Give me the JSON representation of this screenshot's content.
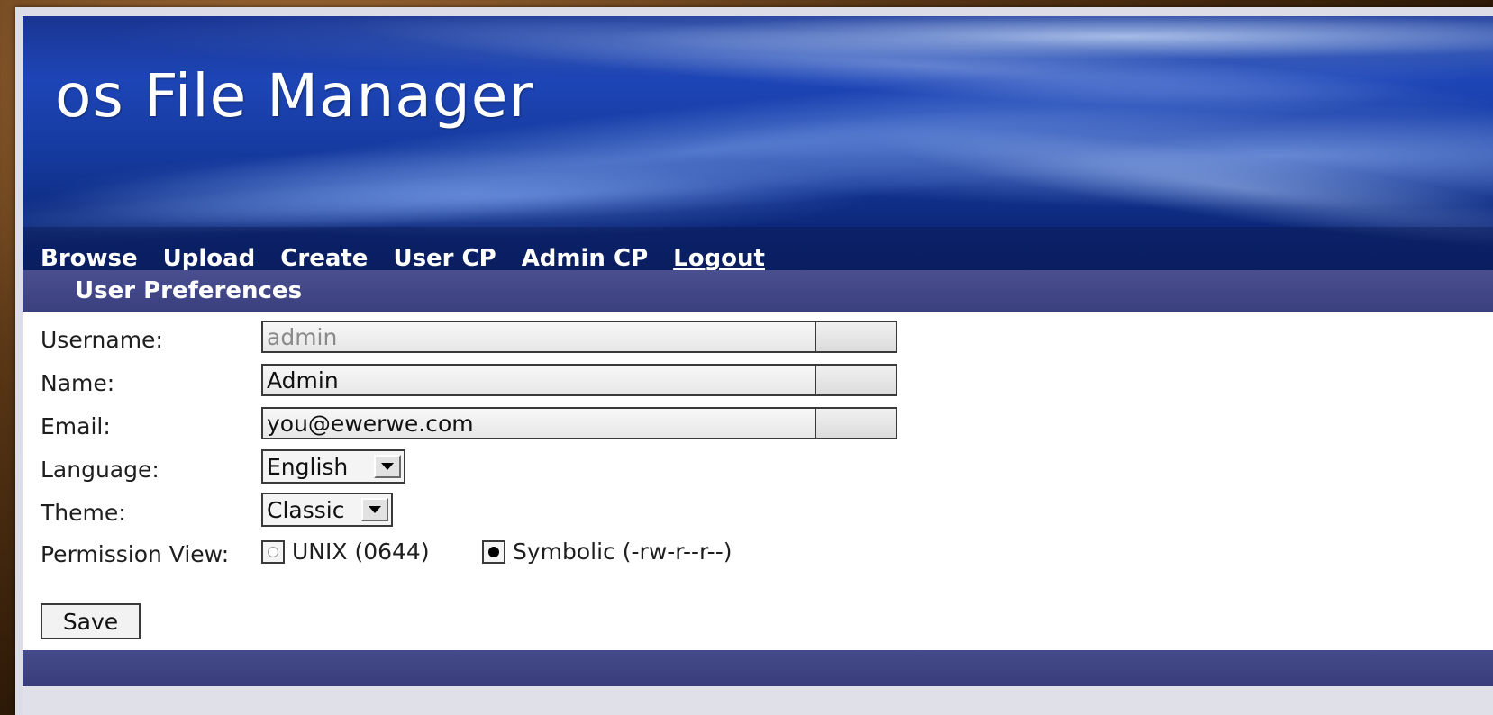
{
  "app": {
    "title": "os File Manager"
  },
  "nav": {
    "items": [
      {
        "id": "browse",
        "label": "Browse"
      },
      {
        "id": "upload",
        "label": "Upload"
      },
      {
        "id": "create",
        "label": "Create"
      },
      {
        "id": "user-cp",
        "label": "User CP"
      },
      {
        "id": "admin-cp",
        "label": "Admin CP"
      },
      {
        "id": "logout",
        "label": "Logout"
      }
    ]
  },
  "section": {
    "title": "User Preferences"
  },
  "form": {
    "username": {
      "label": "Username:",
      "value": "admin",
      "disabled": true
    },
    "name": {
      "label": "Name:",
      "value": "Admin"
    },
    "email": {
      "label": "Email:",
      "value": "you@ewerwe.com"
    },
    "language": {
      "label": "Language:",
      "selected": "English"
    },
    "theme": {
      "label": "Theme:",
      "selected": "Classic"
    },
    "permission_view": {
      "label": "Permission View:",
      "options": [
        {
          "label": "UNIX (0644)",
          "checked": false
        },
        {
          "label": "Symbolic (-rw-r--r--)",
          "checked": true
        }
      ]
    },
    "save_label": "Save"
  },
  "colors": {
    "header_bar": "#3f4485",
    "banner_blue": "#1d45b6",
    "page_frame": "#dcdde6",
    "outer_background": "#3a210a"
  },
  "icons": {
    "select_arrow": "chevron-down-icon",
    "radio_checked": "radio-checked-icon",
    "radio_unchecked": "radio-unchecked-icon"
  }
}
